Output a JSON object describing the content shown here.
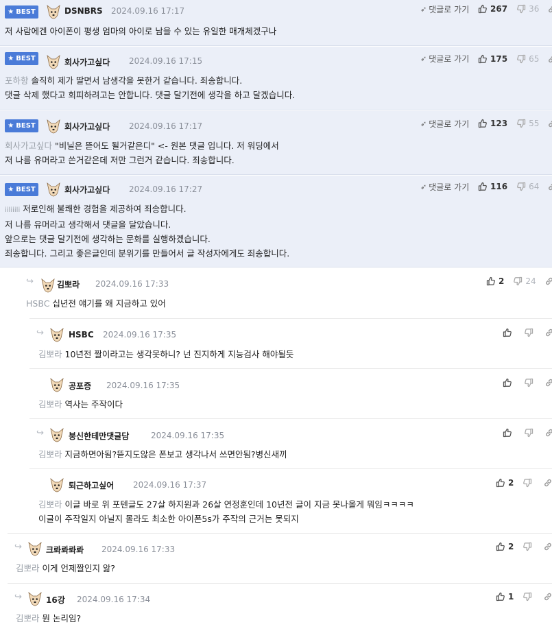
{
  "best_label": "BEST",
  "goto_label": "댓글로 가기",
  "best_comments": [
    {
      "nick": "DSNBRS",
      "date": "2024.09.16 17:17",
      "up": "267",
      "down": "36",
      "lines": [
        {
          "mention": "",
          "text": "저 사람에겐 아이폰이 평생 엄마의 아이로 남을 수 있는 유일한 매개체겠구나"
        }
      ]
    },
    {
      "nick": "회사가고싶다",
      "date": "2024.09.16 17:15",
      "up": "175",
      "down": "65",
      "lines": [
        {
          "mention": "포하항",
          "text": " 솔직히 제가 딸면서 남생각을 못한거 같습니다. 죄송합니다."
        },
        {
          "mention": "",
          "text": "댓글 삭제 했다고 회피하려고는 안합니다. 댓글 달기전에 생각을 하고 달겠습니다."
        }
      ]
    },
    {
      "nick": "회사가고싶다",
      "date": "2024.09.16 17:17",
      "up": "123",
      "down": "55",
      "lines": [
        {
          "mention": "회사가고싶다",
          "text": " \"비닐은 뜯어도 될거같은디\" <- 원본 댓글 입니다. 저 워딩에서"
        },
        {
          "mention": "",
          "text": "저 나름 유머라고 쓴거같은데 저만 그런거 같습니다. 죄송합니다."
        }
      ]
    },
    {
      "nick": "회사가고싶다",
      "date": "2024.09.16 17:27",
      "up": "116",
      "down": "64",
      "lines": [
        {
          "mention": "iiliiili",
          "text": " 저로인해 불쾌한 경험을 제공하여 죄송합니다."
        },
        {
          "mention": "",
          "text": "저 나름 유머라고 생각해서 댓글을 달았습니다."
        },
        {
          "mention": "",
          "text": "앞으로는 댓글 달기전에 생각하는 문화를 실행하겠습니다."
        },
        {
          "mention": "",
          "text": "죄송합니다. 그리고 좋은글인데 분위기를 만들어서 글 작성자에게도 죄송합니다."
        }
      ]
    }
  ],
  "replies": [
    {
      "nick": "김뽀라",
      "date": "2024.09.16 17:33",
      "up": "2",
      "down": "24",
      "lines": [
        {
          "mention": "HSBC",
          "text": " 십년전 얘기를 왜 지금하고 있어"
        }
      ]
    },
    {
      "nick": "HSBC",
      "date": "2024.09.16 17:35",
      "up": "",
      "down": "",
      "lines": [
        {
          "mention": "김뽀라",
          "text": " 10년전 짤이라고는 생각못하니? 넌 진지하게 지능검사 해야될듯"
        }
      ]
    },
    {
      "nick": "공포증",
      "date": "2024.09.16 17:35",
      "up": "",
      "down": "",
      "lines": [
        {
          "mention": "김뽀라",
          "text": " 역사는 주작이다"
        }
      ]
    },
    {
      "nick": "붕신한테만댓글담",
      "date": "2024.09.16 17:35",
      "up": "",
      "down": "",
      "lines": [
        {
          "mention": "김뽀라",
          "text": " 지금하면아됨?뜯지도않은 폰보고 생각나서 쓰면안됨?병신새끼"
        }
      ]
    },
    {
      "nick": "퇴근하고싶어",
      "date": "2024.09.16 17:37",
      "up": "2",
      "down": "",
      "lines": [
        {
          "mention": "김뽀라",
          "text": " 이글 바로 위 포텐글도 27살 하지원과 26살 연정훈인데 10년전 글이 지금 못나올게 뭐임ㅋㅋㅋㅋ"
        },
        {
          "mention": "",
          "text": "이글이 주작일지 아닐지 몰라도 최소한 아이폰5s가 주작의 근거는 못되지"
        }
      ]
    },
    {
      "nick": "크롸롸롸롸",
      "date": "2024.09.16 17:33",
      "up": "2",
      "down": "",
      "lines": [
        {
          "mention": "김뽀라",
          "text": " 이게 언제짤인지 앎?"
        }
      ]
    },
    {
      "nick": "16강",
      "date": "2024.09.16 17:34",
      "up": "1",
      "down": "",
      "lines": [
        {
          "mention": "김뽀라",
          "text": " 뭔 논리임?"
        }
      ]
    }
  ],
  "colors": {
    "best_bg": "#ebeff8",
    "badge": "#4a7bd8",
    "muted": "#8a8f99",
    "mention": "#9aa0a8"
  }
}
